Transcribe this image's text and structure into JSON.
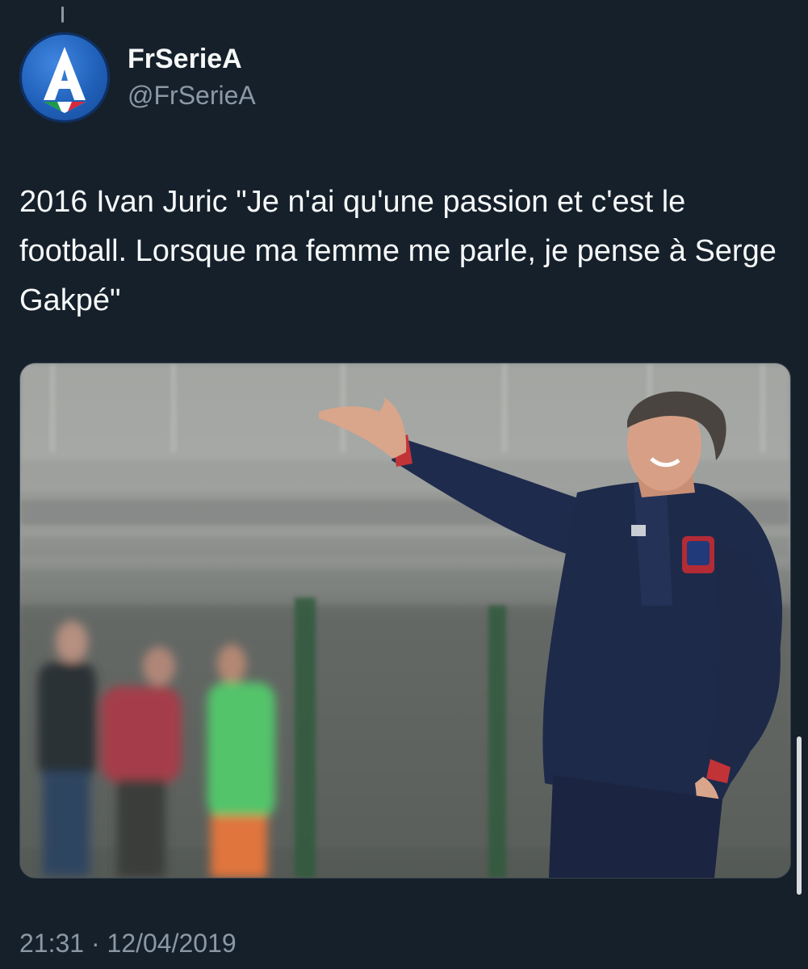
{
  "tweet": {
    "author": {
      "display_name": "FrSerieA",
      "handle": "@FrSerieA",
      "avatar_icon": "serie-a-logo-icon"
    },
    "text": "2016 Ivan Juric \"Je n'ai qu'une passion et c'est le football. Lorsque ma femme me parle, je pense à Serge Gakpé\"",
    "media": {
      "type": "photo"
    },
    "time": "21:31",
    "separator": "·",
    "date": "12/04/2019"
  },
  "colors": {
    "background": "#15202b",
    "text_primary": "#f7f9f9",
    "text_secondary": "#8b98a5",
    "serie_a_blue": "#1f5fb8"
  }
}
